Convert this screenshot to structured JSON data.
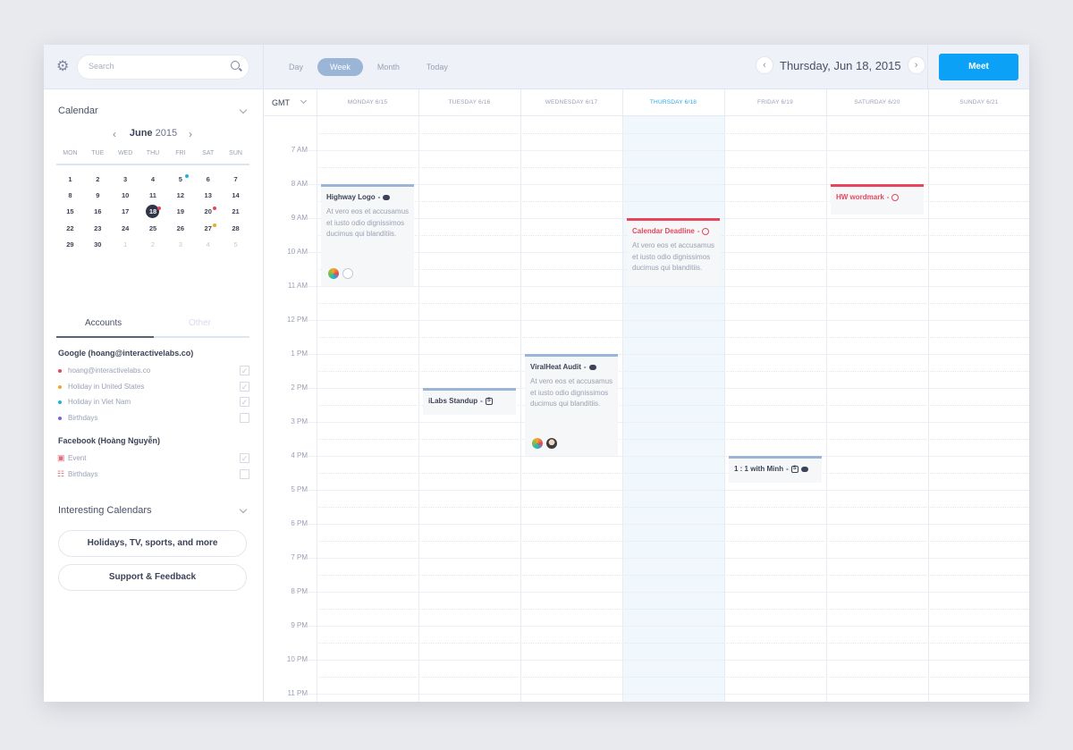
{
  "toolbar": {
    "search_placeholder": "Search",
    "views": [
      {
        "label": "Day",
        "active": false
      },
      {
        "label": "Week",
        "active": true
      },
      {
        "label": "Month",
        "active": false
      },
      {
        "label": "Today",
        "active": false
      }
    ],
    "current_date": "Thursday, Jun 18, 2015",
    "meet_label": "Meet",
    "accent_color": "#0aa1f7"
  },
  "sidebar": {
    "calendar_title": "Calendar",
    "mini_cal": {
      "month": "June",
      "year": "2015",
      "weekdays": [
        "MON",
        "TUE",
        "WED",
        "THU",
        "FRI",
        "SAT",
        "SUN"
      ],
      "days": [
        {
          "d": "1"
        },
        {
          "d": "2"
        },
        {
          "d": "3"
        },
        {
          "d": "4"
        },
        {
          "d": "5",
          "dot": "#19b6d6"
        },
        {
          "d": "6"
        },
        {
          "d": "7"
        },
        {
          "d": "8"
        },
        {
          "d": "9"
        },
        {
          "d": "10"
        },
        {
          "d": "11"
        },
        {
          "d": "12"
        },
        {
          "d": "13"
        },
        {
          "d": "14"
        },
        {
          "d": "15"
        },
        {
          "d": "16"
        },
        {
          "d": "17"
        },
        {
          "d": "18",
          "selected": true,
          "dot": "#e8455d"
        },
        {
          "d": "19"
        },
        {
          "d": "20",
          "dot": "#e8455d"
        },
        {
          "d": "21"
        },
        {
          "d": "22"
        },
        {
          "d": "23"
        },
        {
          "d": "24"
        },
        {
          "d": "25"
        },
        {
          "d": "26"
        },
        {
          "d": "27",
          "dot": "#f5a623"
        },
        {
          "d": "28"
        },
        {
          "d": "29"
        },
        {
          "d": "30"
        },
        {
          "d": "1",
          "dim": true
        },
        {
          "d": "2",
          "dim": true
        },
        {
          "d": "3",
          "dim": true
        },
        {
          "d": "4",
          "dim": true
        },
        {
          "d": "5",
          "dim": true
        }
      ]
    },
    "tabs": {
      "accounts": "Accounts",
      "other": "Other"
    },
    "google": {
      "title": "Google (hoang@interactivelabs.co)",
      "items": [
        {
          "label": "hoang@interactivelabs.co",
          "color": "#e8455d",
          "checked": true
        },
        {
          "label": "Holiday in United States",
          "color": "#f5a623",
          "checked": true
        },
        {
          "label": "Holiday in Viet Nam",
          "color": "#19b6d6",
          "checked": true
        },
        {
          "label": "Birthdays",
          "color": "#7b61d6",
          "checked": false
        }
      ]
    },
    "facebook": {
      "title": "Facebook (Hoàng Nguyễn)",
      "items": [
        {
          "label": "Event",
          "icon": "calendar-icon",
          "checked": true
        },
        {
          "label": "Birthdays",
          "icon": "gift-icon",
          "checked": false
        }
      ]
    },
    "interesting_title": "Interesting Calendars",
    "buttons": {
      "holidays": "Holidays, TV, sports, and more",
      "support": "Support & Feedback"
    }
  },
  "week": {
    "timezone": "GMT",
    "days": [
      {
        "label": "MONDAY 6/15",
        "today": false
      },
      {
        "label": "TUESDAY 6/16",
        "today": false
      },
      {
        "label": "WEDNESDAY 6/17",
        "today": false
      },
      {
        "label": "THURSDAY 6/18",
        "today": true
      },
      {
        "label": "FRIDAY 6/19",
        "today": false
      },
      {
        "label": "SATURDAY 6/20",
        "today": false
      },
      {
        "label": "SUNDAY 6/21",
        "today": false
      }
    ],
    "hours": [
      "7 AM",
      "8 AM",
      "9 AM",
      "10 AM",
      "11 AM",
      "12 PM",
      "1 PM",
      "2 PM",
      "3 PM",
      "4 PM",
      "5 PM",
      "6 PM",
      "7 PM",
      "8 PM",
      "9 PM",
      "10 PM",
      "11 PM"
    ],
    "events": [
      {
        "title": "Highway Logo",
        "day": 0,
        "start": 8,
        "end": 11,
        "color": "blue",
        "icons": [
          "chat-icon"
        ],
        "desc": "At vero eos et accusamus et iusto odio dignissimos ducimus qui blanditiis.",
        "avatars": [
          "colorful-avatar",
          "empty-avatar"
        ]
      },
      {
        "title": "iLabs Standup",
        "day": 1,
        "start": 14,
        "end": 14.8,
        "color": "blue",
        "icons": [
          "skype-icon"
        ],
        "desc": "",
        "avatars": []
      },
      {
        "title": "ViralHeat Audit",
        "day": 2,
        "start": 13,
        "end": 16,
        "color": "blue",
        "icons": [
          "chat-icon"
        ],
        "desc": "At vero eos et accusamus et iusto odio dignissimos ducimus qui blanditiis.",
        "avatars": [
          "colorful-avatar",
          "person-avatar"
        ]
      },
      {
        "title": "Calendar Deadline",
        "day": 3,
        "start": 9,
        "end": 11,
        "color": "red",
        "icons": [
          "clock-icon"
        ],
        "desc": "At vero eos et accusamus et iusto odio dignissimos ducimus qui blanditiis.",
        "avatars": []
      },
      {
        "title": "1 : 1 with Minh",
        "day": 4,
        "start": 16,
        "end": 16.8,
        "color": "blue",
        "icons": [
          "skype-icon",
          "chat-icon"
        ],
        "desc": "",
        "avatars": []
      },
      {
        "title": "HW wordmark",
        "day": 5,
        "start": 8,
        "end": 8.9,
        "color": "red",
        "icons": [
          "clock-icon"
        ],
        "desc": "",
        "avatars": []
      }
    ]
  }
}
